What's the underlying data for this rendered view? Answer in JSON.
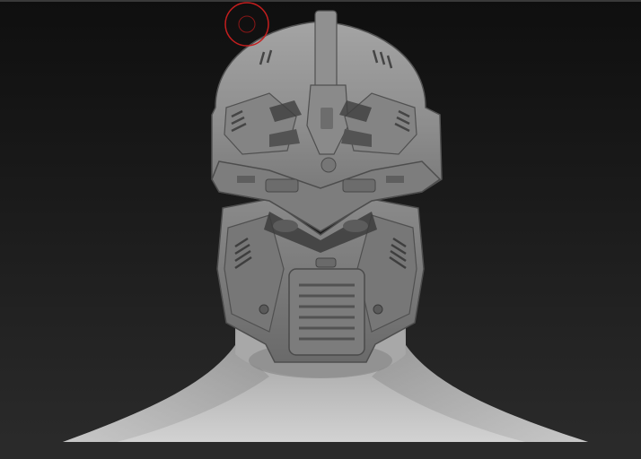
{
  "viewport": {
    "background_top": "#0f0f0f",
    "background_bottom": "#2b2b2b"
  },
  "model": {
    "subject": "helmet-bust-icon",
    "material_color": "#8a8a8a"
  },
  "brush_cursor": {
    "icon": "brush-cursor-icon",
    "color": "#c41e1e"
  }
}
